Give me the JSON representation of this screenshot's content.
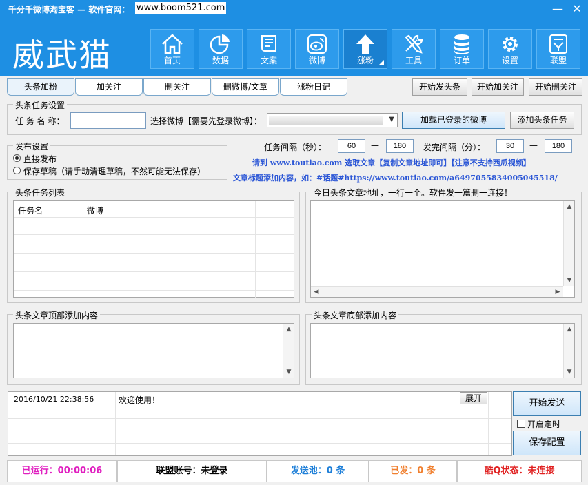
{
  "window": {
    "title": "千分千微博淘宝客 — 软件官网：",
    "url": "www.boom521.com",
    "minimize": "—",
    "close": "✕"
  },
  "logo": "威武猫",
  "nav": [
    {
      "label": "首页",
      "icon": "home-icon"
    },
    {
      "label": "数据",
      "icon": "pie-chart-icon"
    },
    {
      "label": "文案",
      "icon": "scroll-icon"
    },
    {
      "label": "微博",
      "icon": "weibo-icon"
    },
    {
      "label": "涨粉",
      "icon": "up-arrow-icon"
    },
    {
      "label": "工具",
      "icon": "tools-icon"
    },
    {
      "label": "订单",
      "icon": "database-icon"
    },
    {
      "label": "设置",
      "icon": "gear-icon"
    },
    {
      "label": "联盟",
      "icon": "alliance-icon"
    }
  ],
  "tabs": [
    "头条加粉",
    "加关注",
    "删关注",
    "删微博/文章",
    "涨粉日记"
  ],
  "top_buttons": [
    "开始发头条",
    "开始加关注",
    "开始删关注"
  ],
  "task_settings": {
    "title": "头条任务设置",
    "name_label": "任 务 名 称：",
    "name_value": "",
    "weibo_label": "选择微博【需要先登录微博】：",
    "load_button": "加载已登录的微博",
    "add_button": "添加头条任务"
  },
  "publish_settings": {
    "title": "发布设置",
    "options": [
      "直接发布",
      "保存草稿（请手动清理草稿，不然可能无法保存）"
    ],
    "selected": 0
  },
  "intervals": {
    "task_label": "任务间隔（秒）：",
    "task_min": "60",
    "task_max": "180",
    "send_label": "发完间隔（分）：",
    "send_min": "30",
    "send_max": "180",
    "dash": "—"
  },
  "tips": {
    "line1": "请到 www.toutiao.com 选取文章【复制文章地址即可】【注意不支持西瓜视频】",
    "line2": "文章标题添加内容，如：#话题#https://www.toutiao.com/a6497055834005045518/"
  },
  "task_list": {
    "title": "头条任务列表",
    "columns": [
      "任务名",
      "微博"
    ]
  },
  "url_box": {
    "title": "今日头条文章地址，一行一个。软件发一篇删一连接！"
  },
  "top_content": {
    "title": "头条文章顶部添加内容"
  },
  "bottom_content": {
    "title": "头条文章底部添加内容"
  },
  "log": {
    "timestamp": "2016/10/21 22:38:56",
    "message": "欢迎使用！",
    "expand_button": "展开"
  },
  "side_buttons": {
    "start_send": "开始发送",
    "schedule": "开启定时",
    "save_config": "保存配置"
  },
  "status_bar": {
    "running": "已运行：00:00:06",
    "account": "联盟账号：未登录",
    "pool": "发送池：0 条",
    "sent": "已发：0 条",
    "qq": "酷Q状态：未连接"
  },
  "colors": {
    "header_bg": "#1e8fe3",
    "running": "#e020c0",
    "pool": "#1e7fd8",
    "sent": "#f08030",
    "qq": "#e02020",
    "tip": "#2c57d6"
  }
}
